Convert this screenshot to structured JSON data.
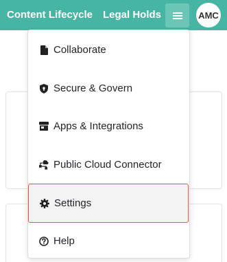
{
  "topbar": {
    "links": [
      {
        "label": "Content Lifecycle"
      },
      {
        "label": "Legal Holds"
      }
    ],
    "menu_icon": "hamburger-icon",
    "avatar_initials": "AMC",
    "background_color": "#47b5a3"
  },
  "dropdown": {
    "items": [
      {
        "label": "Collaborate",
        "icon": "document-icon"
      },
      {
        "label": "Secure & Govern",
        "icon": "shield-icon"
      },
      {
        "label": "Apps & Integrations",
        "icon": "store-icon"
      },
      {
        "label": "Public Cloud Connector",
        "icon": "cloud-connector-icon"
      },
      {
        "label": "Settings",
        "icon": "gear-icon",
        "highlighted": true
      },
      {
        "label": "Help",
        "icon": "help-circle-icon"
      }
    ],
    "highlight_color": "#e05a3a"
  }
}
